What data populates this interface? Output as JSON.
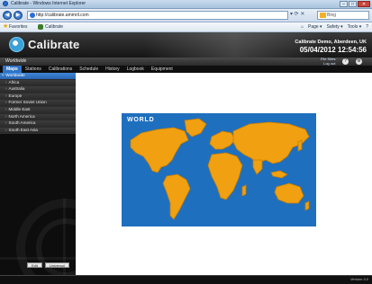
{
  "browser": {
    "window_title": "Calibrate - Windows Internet Explorer",
    "url": "http://calibrate.ammril.com",
    "search_placeholder": "Bing",
    "favorites_label": "Favorites",
    "tab_label": "Calibrate",
    "command_items": [
      "Page ▾",
      "Safety ▾",
      "Tools ▾",
      "?"
    ]
  },
  "app": {
    "logo_text": "Calibrate",
    "company": "Calibrate Demo, Aberdeen, UK",
    "datetime": "05/04/2012 12:54:56",
    "breadcrumb": "Worldwide",
    "help_links": [
      "File Sites",
      "Log out"
    ]
  },
  "menu": {
    "items": [
      "Maps",
      "Stations",
      "Calibrations",
      "Schedule",
      "History",
      "Logbook",
      "Equipment"
    ],
    "active": "Maps"
  },
  "sidebar": {
    "items": [
      {
        "label": "Worldwide",
        "selected": true
      },
      {
        "label": "Africa",
        "selected": false
      },
      {
        "label": "Australia",
        "selected": false
      },
      {
        "label": "Europe",
        "selected": false
      },
      {
        "label": "Former Soviet Union",
        "selected": false
      },
      {
        "label": "Middle East",
        "selected": false
      },
      {
        "label": "North America",
        "selected": false
      },
      {
        "label": "South America",
        "selected": false
      },
      {
        "label": "South East Asia",
        "selected": false
      }
    ],
    "buttons": [
      "Edit",
      "Universal"
    ]
  },
  "map": {
    "title": "WORLD",
    "ocean_color": "#1f6fbf",
    "land_color": "#f0a010"
  },
  "status": {
    "version": "Version 4.0"
  }
}
